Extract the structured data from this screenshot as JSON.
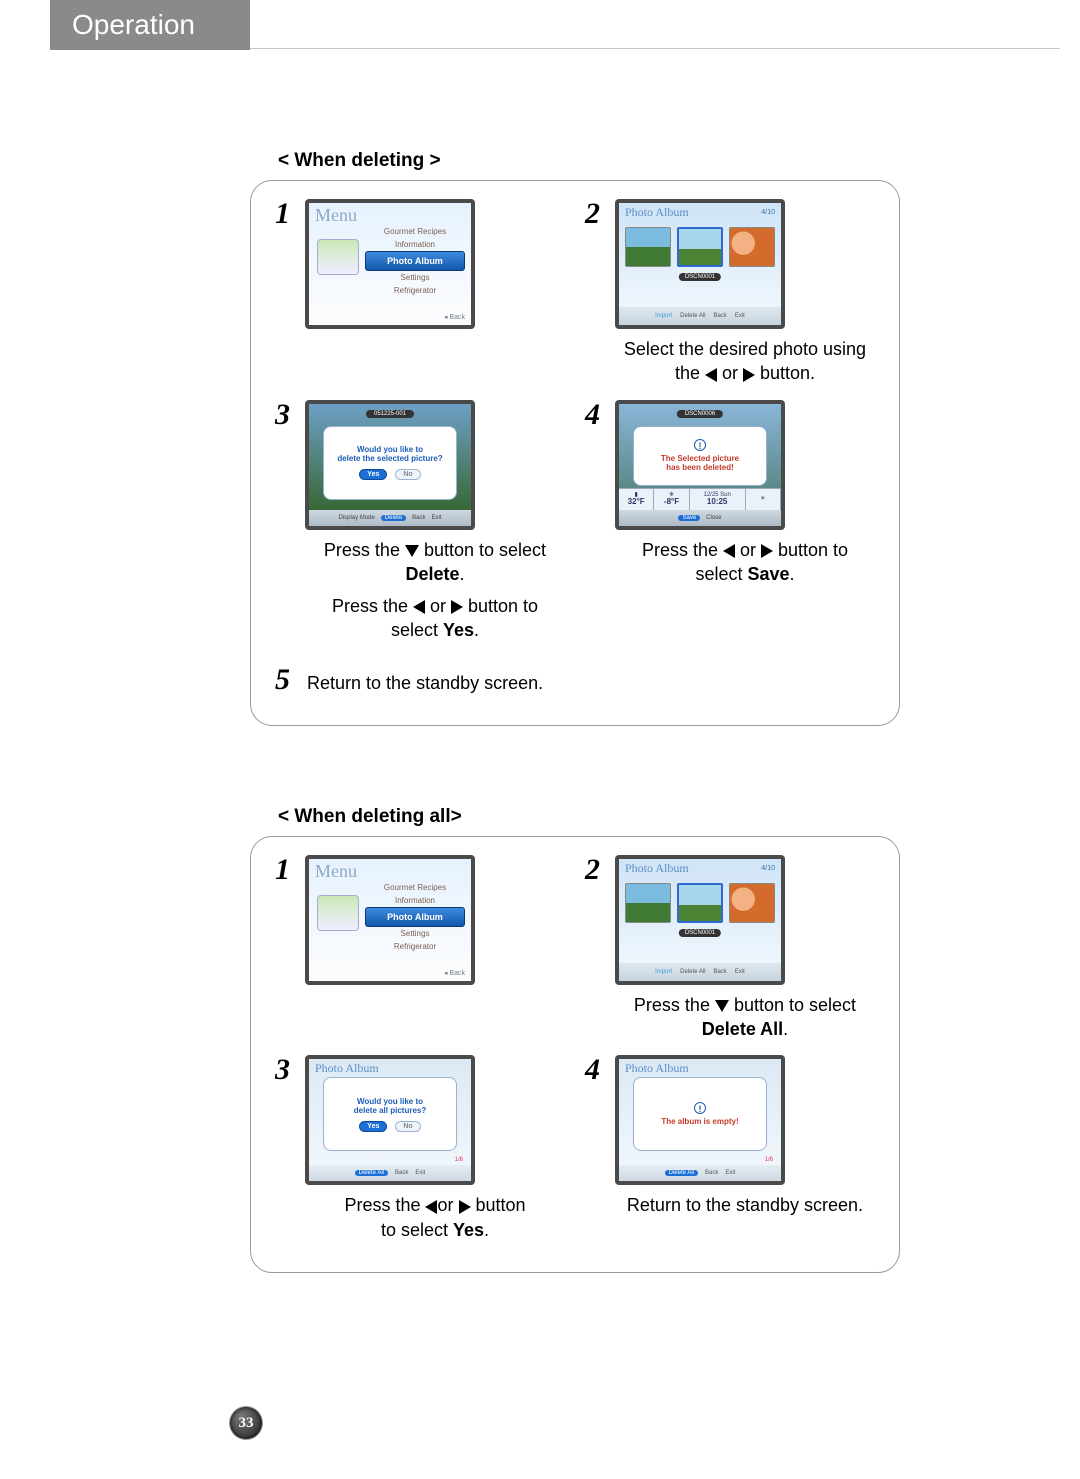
{
  "page": {
    "heading": "Operation",
    "number": "33"
  },
  "sections": [
    {
      "title": "< When deleting >"
    },
    {
      "title": "< When deleting all>"
    }
  ],
  "menu_screen": {
    "title": "Menu",
    "items": [
      "Gourmet Recipes",
      "Information",
      "Photo Album",
      "Settings",
      "Refrigerator"
    ],
    "back": "◂ Back"
  },
  "album_screen": {
    "title": "Photo Album",
    "count": "4/10",
    "selected_label": "DSCN0001",
    "buttons": [
      "Import",
      "Delete All",
      "Back",
      "Exit"
    ]
  },
  "s1": {
    "step2_caption_a": "Select the desired photo using",
    "step2_caption_b": "the ",
    "step2_caption_c": " or ",
    "step2_caption_d": " button.",
    "step3_screen": {
      "pill": "051225-001",
      "line1": "Would you like to",
      "line2": "delete the selected picture?",
      "yes": "Yes",
      "no": "No",
      "footer": [
        "Display Mode",
        "Delete",
        "Back",
        "Exit"
      ]
    },
    "step3_cap_a": "Press the ",
    "step3_cap_b": " button to select",
    "step3_cap_bold": "Delete",
    "step3_cap_c": ".",
    "step3_cap2_a": "Press the ",
    "step3_cap2_b": " or ",
    "step3_cap2_c": " button to",
    "step3_cap2_d": "select ",
    "step3_cap2_bold": "Yes",
    "step3_cap2_e": ".",
    "step4_screen": {
      "pill": "DSCN0006",
      "line1": "The Selected picture",
      "line2": "has been deleted!",
      "status": {
        "temp1": "32°F",
        "temp2": "-8°F",
        "date": "12/25 Sun",
        "time": "10:25",
        "save": "Save",
        "close": "Close"
      }
    },
    "step4_cap_a": "Press the ",
    "step4_cap_b": " or ",
    "step4_cap_c": " button to",
    "step4_cap_d": "select ",
    "step4_cap_bold": "Save",
    "step4_cap_e": ".",
    "step5": "Return to the standby screen."
  },
  "s2": {
    "step2_cap_a": "Press the ",
    "step2_cap_b": " button to select",
    "step2_cap_bold": "Delete All",
    "step2_cap_c": ".",
    "step3_screen": {
      "title": "Photo Album",
      "line1": "Would you like to",
      "line2": "delete all pictures?",
      "yes": "Yes",
      "no": "No",
      "count": "1/6",
      "footer": [
        "Delete All",
        "Back",
        "Exit"
      ]
    },
    "step3_cap_a": "Press the ",
    "step3_cap_b": "or ",
    "step3_cap_c": " button",
    "step3_cap_d": "to select ",
    "step3_cap_bold": "Yes",
    "step3_cap_e": ".",
    "step4_screen": {
      "title": "Photo Album",
      "line1": "The album is empty!",
      "count": "1/6",
      "footer": [
        "Delete All",
        "Back",
        "Exit"
      ]
    },
    "step4_cap": "Return to the standby screen."
  },
  "nums": {
    "n1": "1",
    "n2": "2",
    "n3": "3",
    "n4": "4",
    "n5": "5"
  }
}
